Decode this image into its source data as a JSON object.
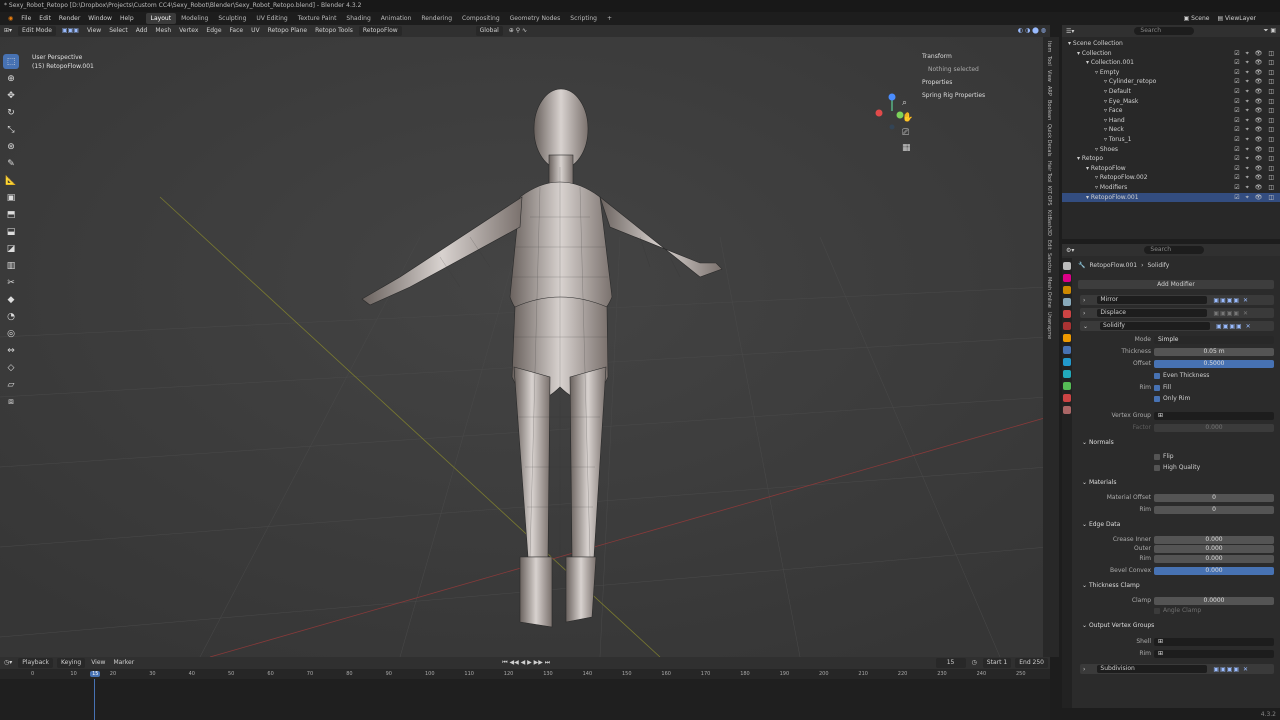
{
  "window": {
    "title": "* Sexy_Robot_Retopo [D:\\Dropbox\\Projects\\Custom CC4\\Sexy_Robot\\Blender\\Sexy_Robot_Retopo.blend] - Blender 4.3.2"
  },
  "menu": [
    "File",
    "Edit",
    "Render",
    "Window",
    "Help"
  ],
  "workspaces": [
    "Layout",
    "Modeling",
    "Sculpting",
    "UV Editing",
    "Texture Paint",
    "Shading",
    "Animation",
    "Rendering",
    "Compositing",
    "Geometry Nodes",
    "Scripting"
  ],
  "scene": {
    "scene_label": "Scene",
    "viewlayer_label": "ViewLayer"
  },
  "header3d": {
    "mode": "Edit Mode",
    "items": [
      "View",
      "Select",
      "Add",
      "Mesh",
      "Vertex",
      "Edge",
      "Face",
      "UV",
      "Retopo Plane",
      "Retopo Tools"
    ],
    "retopoflow": "RetopoFlow",
    "orientation": "Global",
    "options": "Options"
  },
  "viewport": {
    "perspective": "User Perspective",
    "object": "(15) RetopoFlow.001"
  },
  "npanel": {
    "transform": "Transform",
    "nothing": "Nothing selected",
    "properties": "Properties",
    "spring": "Spring Rig Properties"
  },
  "vtabs": [
    "Item",
    "Tool",
    "View",
    "ARP",
    "Boolean",
    "Quick Decals",
    "Hair Tool",
    "KIT OPS",
    "KitBash3D",
    "Edit",
    "Sanctus",
    "Mesh Online",
    "Unwrapme",
    "Retopology",
    "CC/iC Pipeline",
    "CC/iC Create",
    "CC/iC Link"
  ],
  "outliner": {
    "search": "Search",
    "rows": [
      {
        "label": "Scene Collection",
        "indent": 0
      },
      {
        "label": "Collection",
        "indent": 1
      },
      {
        "label": "Collection.001",
        "indent": 2
      },
      {
        "label": "Empty",
        "indent": 3
      },
      {
        "label": "Cylinder_retopo",
        "indent": 4
      },
      {
        "label": "Default",
        "indent": 4
      },
      {
        "label": "Eye_Mask",
        "indent": 4
      },
      {
        "label": "Face",
        "indent": 4
      },
      {
        "label": "Hand",
        "indent": 4
      },
      {
        "label": "Neck",
        "indent": 4
      },
      {
        "label": "Torus_1",
        "indent": 4
      },
      {
        "label": "Shoes",
        "indent": 3
      },
      {
        "label": "Retopo",
        "indent": 1
      },
      {
        "label": "RetopoFlow",
        "indent": 2
      },
      {
        "label": "RetopoFlow.002",
        "indent": 3
      },
      {
        "label": "Modifiers",
        "indent": 3
      },
      {
        "label": "RetopoFlow.001",
        "indent": 2
      }
    ]
  },
  "props": {
    "search": "Search",
    "breadcrumb_obj": "RetopoFlow.001",
    "breadcrumb_mod": "Solidify",
    "add_modifier": "Add Modifier",
    "modifiers": [
      "Mirror",
      "Displace",
      "Solidify",
      "Subdivision"
    ],
    "mode_label": "Mode",
    "mode_value": "Simple",
    "thickness_label": "Thickness",
    "thickness_value": "0.05 m",
    "offset_label": "Offset",
    "offset_value": "0.5000",
    "even_thickness": "Even Thickness",
    "rim_label": "Rim",
    "fill": "Fill",
    "only_rim": "Only Rim",
    "vgroup_label": "Vertex Group",
    "factor_label": "Factor",
    "factor_value": "0.000",
    "normals": "Normals",
    "flip": "Flip",
    "high_quality": "High Quality",
    "materials": "Materials",
    "mat_offset_label": "Material Offset",
    "mat_offset_value": "0",
    "mat_rim_label": "Rim",
    "mat_rim_value": "0",
    "edge_data": "Edge Data",
    "crease_inner_label": "Crease Inner",
    "crease_inner_value": "0.000",
    "outer_label": "Outer",
    "outer_value": "0.000",
    "ed_rim_label": "Rim",
    "ed_rim_value": "0.000",
    "bevel_label": "Bevel Convex",
    "bevel_value": "0.000",
    "thickness_clamp": "Thickness Clamp",
    "clamp_label": "Clamp",
    "clamp_value": "0.0000",
    "angle_clamp": "Angle Clamp",
    "output_vg": "Output Vertex Groups",
    "shell_label": "Shell",
    "out_rim_label": "Rim"
  },
  "timeline": {
    "items": [
      "Playback",
      "Keying",
      "View",
      "Marker"
    ],
    "current": "15",
    "start_label": "Start",
    "start": "1",
    "end_label": "End",
    "end": "250",
    "frames": [
      "0",
      "10",
      "15",
      "20",
      "30",
      "40",
      "50",
      "60",
      "70",
      "80",
      "90",
      "100",
      "110",
      "120",
      "130",
      "140",
      "150",
      "160",
      "170",
      "180",
      "190",
      "200",
      "210",
      "220",
      "230",
      "240",
      "250"
    ]
  },
  "status": {
    "version": "4.3.2"
  },
  "colors": {
    "accent": "#4772b3",
    "selected": "#334d80"
  }
}
